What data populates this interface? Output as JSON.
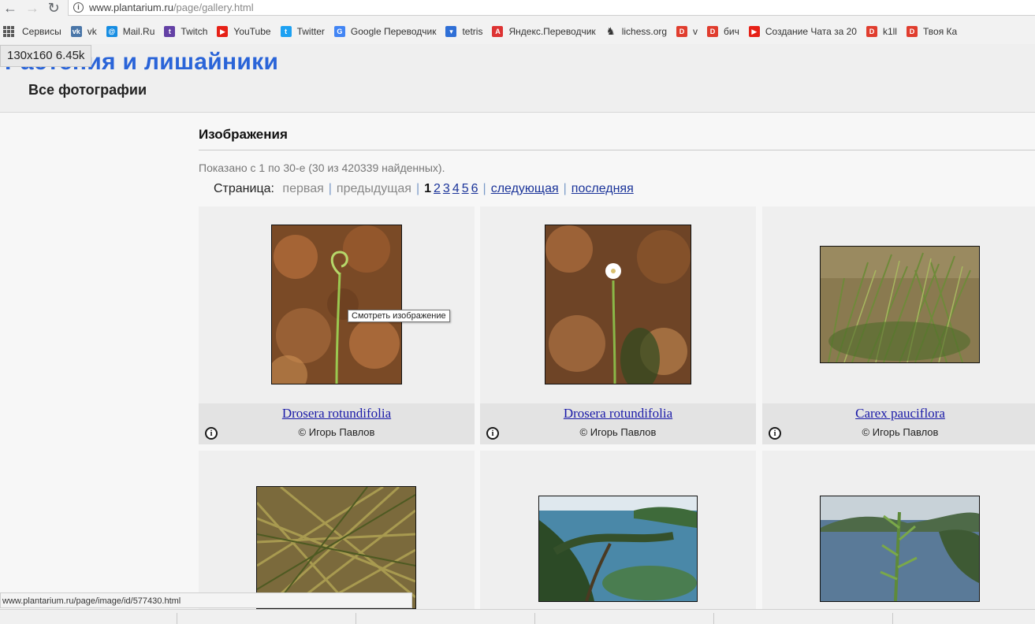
{
  "browser": {
    "url_host": "www.plantarium.ru",
    "url_path": "/page/gallery.html",
    "bookmarks": [
      {
        "label": "Сервисы",
        "icon": "apps-grid-icon",
        "color": "#5a5a5a"
      },
      {
        "label": "vk",
        "icon": "vk-icon",
        "color": "#4a76a8"
      },
      {
        "label": "Mail.Ru",
        "icon": "mailru-icon",
        "color": "#168de2"
      },
      {
        "label": "Twitch",
        "icon": "twitch-icon",
        "color": "#6441a5"
      },
      {
        "label": "YouTube",
        "icon": "youtube-icon",
        "color": "#e62117"
      },
      {
        "label": "Twitter",
        "icon": "twitter-icon",
        "color": "#1da1f2"
      },
      {
        "label": "Google Переводчик",
        "icon": "google-translate-icon",
        "color": "#4285f4"
      },
      {
        "label": "tetris",
        "icon": "shield-icon",
        "color": "#2f6fd6"
      },
      {
        "label": "Яндекс.Переводчик",
        "icon": "yandex-translate-icon",
        "color": "#d33"
      },
      {
        "label": "lichess.org",
        "icon": "knight-icon",
        "color": "#333"
      },
      {
        "label": "v",
        "icon": "d-icon",
        "color": "#e03d2e"
      },
      {
        "label": "бич",
        "icon": "d-icon",
        "color": "#e03d2e"
      },
      {
        "label": "Создание Чата за 20",
        "icon": "youtube-icon",
        "color": "#e62117"
      },
      {
        "label": "k1ll",
        "icon": "d-icon",
        "color": "#e03d2e"
      },
      {
        "label": "Твоя Ка",
        "icon": "d-icon",
        "color": "#e03d2e"
      }
    ],
    "status_url": "www.plantarium.ru/page/image/id/577430.html"
  },
  "page": {
    "size_tip": "130x160 6.45k",
    "site_title": "Растения и лишайники",
    "subtitle": "Все фотографии",
    "section_title": "Изображения",
    "shown_text": "Показано с 1 по 30-е (30 из 420339 найденных).",
    "pager": {
      "label": "Страница:",
      "first": "первая",
      "prev": "предыдущая",
      "current": "1",
      "pages": [
        "2",
        "3",
        "4",
        "5",
        "6"
      ],
      "next": "следующая",
      "last": "последняя"
    },
    "tooltip": "Смотреть изображение",
    "info_glyph": "i",
    "cards": [
      {
        "species": "Drosera rotundifolia",
        "author": "© Игорь Павлов",
        "photo": "sundew-bud"
      },
      {
        "species": "Drosera rotundifolia",
        "author": "© Игорь Павлов",
        "photo": "sundew-flower"
      },
      {
        "species": "Carex pauciflora",
        "author": "© Игорь Павлов",
        "photo": "sedge-tuft"
      },
      {
        "species": "",
        "author": "",
        "photo": "grass-blades"
      },
      {
        "species": "",
        "author": "",
        "photo": "seaside-pine"
      },
      {
        "species": "",
        "author": "",
        "photo": "pine-bay"
      }
    ]
  }
}
